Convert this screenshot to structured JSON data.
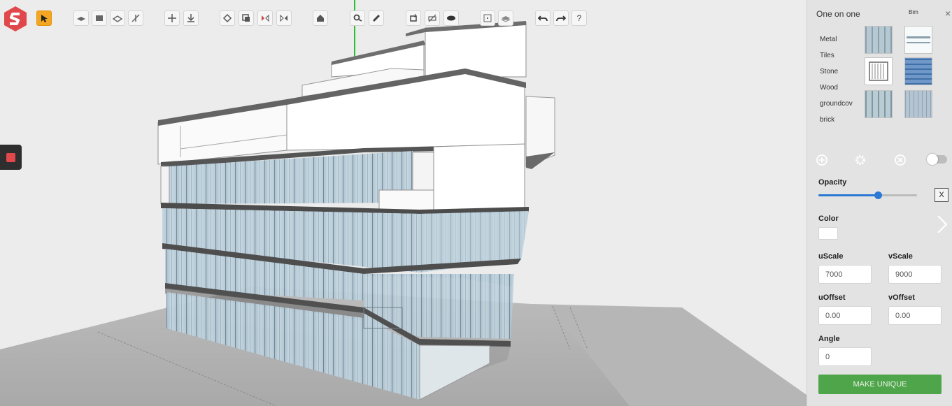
{
  "panel": {
    "title": "One on one",
    "mode": "Bim",
    "close_glyph": "×",
    "materials": [
      "Metal",
      "Tiles",
      "Stone",
      "Wood",
      "groundcov",
      "brick"
    ],
    "opacity_label": "Opacity",
    "opacity_value": 0.6,
    "x_label": "X",
    "color_label": "Color",
    "color_value": "#ffffff",
    "uscale_label": "uScale",
    "uscale_value": "7000",
    "vscale_label": "vScale",
    "vscale_value": "9000",
    "uoffset_label": "uOffset",
    "uoffset_value": "0.00",
    "voffset_label": "vOffset",
    "voffset_value": "0.00",
    "angle_label": "Angle",
    "angle_value": "0",
    "make_unique_label": "MAKE UNIQUE",
    "toggle_on": false
  },
  "toolbar": {
    "help_label": "?",
    "icons": [
      "select-icon",
      "plane-icon",
      "box-icon",
      "section-icon",
      "explode-icon",
      "move-icon",
      "snap-icon",
      "rotate-icon",
      "copy-icon",
      "mirror-icon",
      "flip-icon",
      "home-icon",
      "zoom-icon",
      "measure-icon",
      "orbit-icon",
      "hide-icon",
      "visibility-icon",
      "frame-icon",
      "layers-icon",
      "undo-icon",
      "redo-icon",
      "help-icon"
    ],
    "active": "select-icon"
  },
  "colors": {
    "accent_orange": "#f4a623",
    "brand_red": "#e0484b",
    "slider_blue": "#2a79d4",
    "make_unique_green": "#4ea54a",
    "glass": "#b9cdd7"
  }
}
